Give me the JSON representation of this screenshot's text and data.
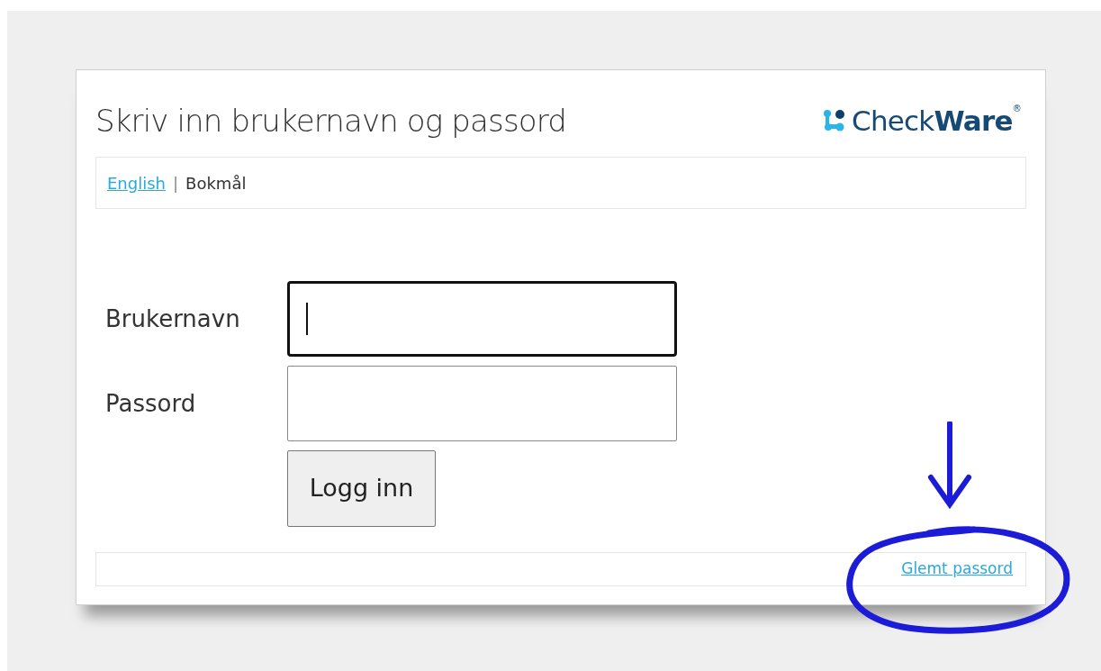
{
  "title": "Skriv inn brukernavn og passord",
  "logo": {
    "text_regular": "Check",
    "text_bold": "Ware",
    "trademark": "®"
  },
  "languages": [
    {
      "label": "English",
      "selected": false
    },
    {
      "label": "Bokmål",
      "selected": true
    }
  ],
  "language_separator": "|",
  "fields": [
    {
      "label": "Brukernavn",
      "focused": true
    },
    {
      "label": "Passord",
      "focused": false
    }
  ],
  "button": "Logg inn",
  "forgot_link": "Glemt passord"
}
